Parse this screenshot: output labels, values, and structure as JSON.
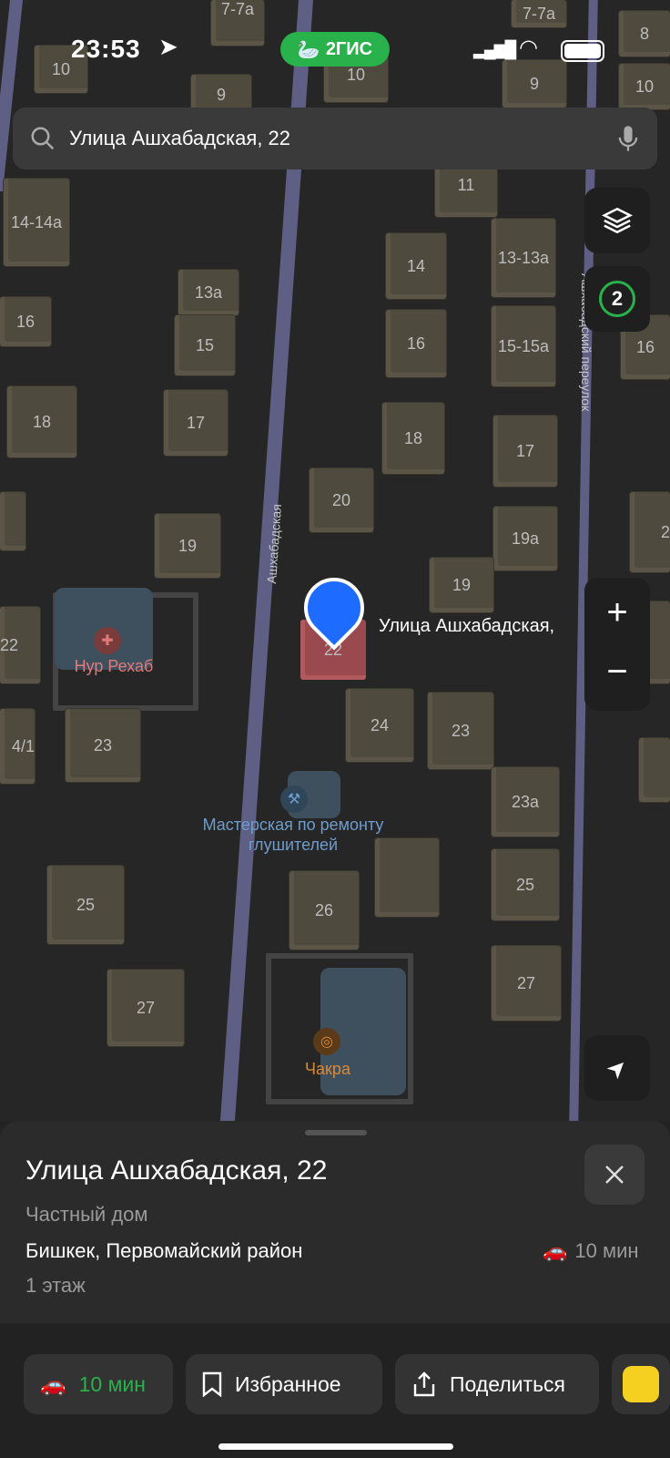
{
  "status_bar": {
    "time": "23:53",
    "brand": "2ГИС"
  },
  "search": {
    "query": "Улица Ашхабадская, 22"
  },
  "map": {
    "street_main": "Ашхабадская",
    "street_side": "Ашхабадский переулок",
    "marker_label": "Улица Ашхабадская,",
    "layers_badge": "2",
    "zoom_in": "+",
    "zoom_out": "−",
    "buildings": [
      "7-7а",
      "10",
      "9",
      "10",
      "7-7а",
      "8",
      "9",
      "10",
      "11",
      "14-14а",
      "14",
      "13-13а",
      "16",
      "13а",
      "16",
      "15-15а",
      "16",
      "15",
      "18",
      "17",
      "18",
      "17",
      "20",
      "19",
      "2",
      "19а",
      "19",
      "22",
      "24",
      "23",
      "4/1",
      "23",
      "23а",
      "25",
      "26",
      "25",
      "27",
      "27",
      "22"
    ],
    "pois": [
      {
        "name": "Нур Рехаб",
        "color": "#e07a7a"
      },
      {
        "name": "Мастерская по ремонту глушителей",
        "color": "#6e9ccc"
      },
      {
        "name": "Чакра",
        "color": "#d9893a"
      }
    ]
  },
  "panel": {
    "title": "Улица Ашхабадская, 22",
    "subtitle": "Частный дом",
    "address": "Бишкек, Первомайский район",
    "eta": "10 мин",
    "floors": "1 этаж",
    "actions": {
      "route": "10 мин",
      "favorite": "Избранное",
      "share": "Поделиться"
    }
  },
  "colors": {
    "accent": "#29b24b",
    "marker": "#1e6bff",
    "panel_bg": "#2b2b2b"
  }
}
